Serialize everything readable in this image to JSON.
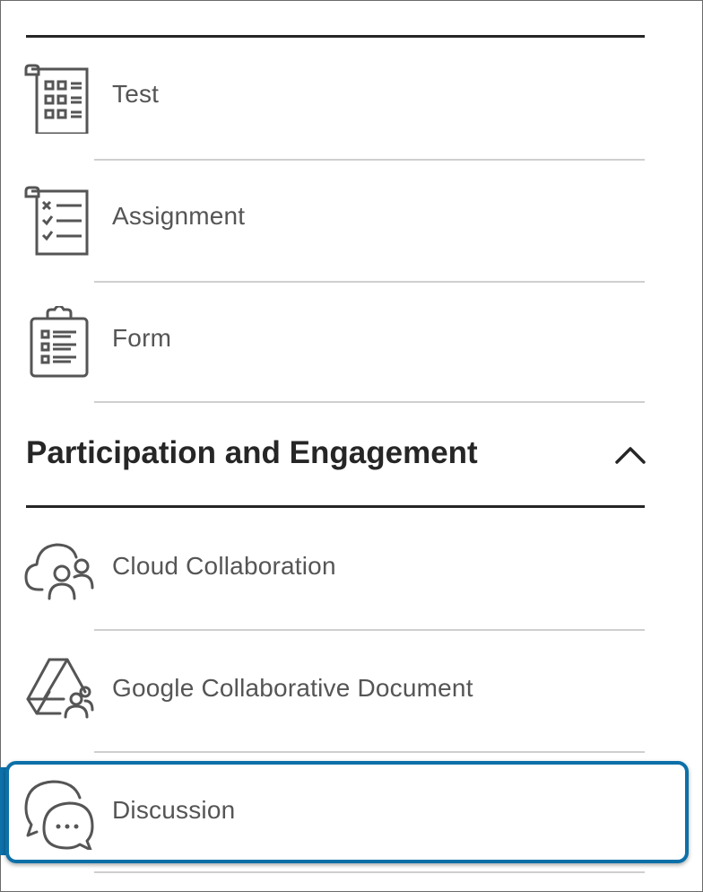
{
  "items": [
    {
      "label": "Test",
      "icon": "test-icon"
    },
    {
      "label": "Assignment",
      "icon": "assignment-icon"
    },
    {
      "label": "Form",
      "icon": "form-icon"
    }
  ],
  "section": {
    "title": "Participation and Engagement",
    "toggle_icon": "chevron-up-icon"
  },
  "section_items": [
    {
      "label": "Cloud Collaboration",
      "icon": "cloud-collaboration-icon"
    },
    {
      "label": "Google Collaborative Document",
      "icon": "google-drive-people-icon"
    },
    {
      "label": "Discussion",
      "icon": "discussion-icon",
      "highlighted": true
    }
  ],
  "colors": {
    "highlight": "#0d70a8",
    "text": "#555555",
    "heading": "#262626"
  }
}
